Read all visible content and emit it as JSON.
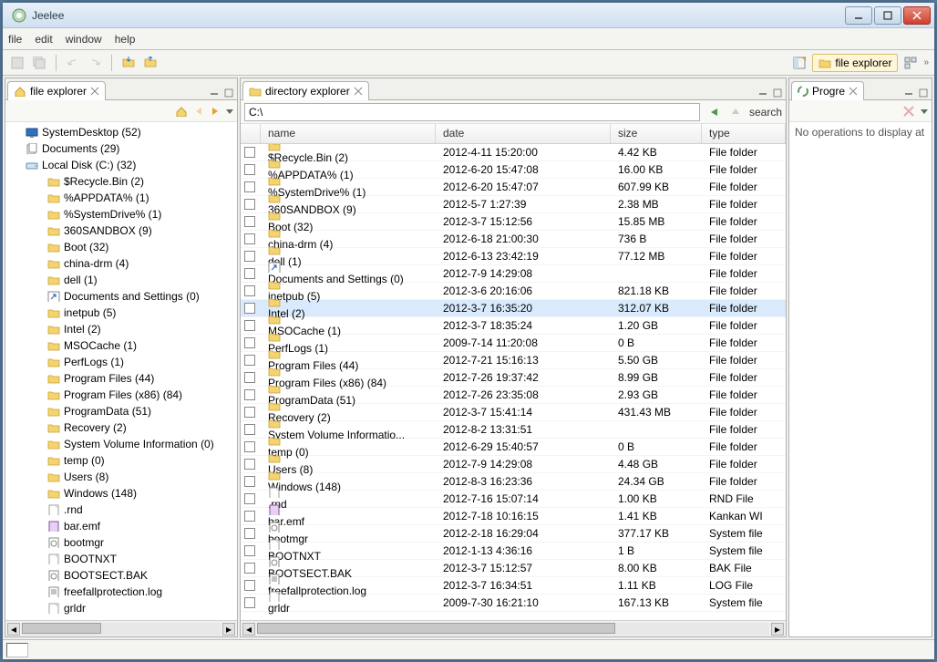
{
  "window": {
    "title": "Jeelee"
  },
  "menu": {
    "file": "file",
    "edit": "edit",
    "window": "window",
    "help": "help"
  },
  "perspective": {
    "label": "file explorer"
  },
  "panes": {
    "left": {
      "tab": "file explorer"
    },
    "mid": {
      "tab": "directory explorer",
      "address": "C:\\",
      "search": "search"
    },
    "right": {
      "tab": "Progre",
      "message": "No operations to display at"
    }
  },
  "columns": {
    "name": "name",
    "date": "date",
    "size": "size",
    "type": "type"
  },
  "tree": [
    {
      "indent": 0,
      "icon": "monitor",
      "label": "SystemDesktop (52)"
    },
    {
      "indent": 0,
      "icon": "docs",
      "label": "Documents (29)"
    },
    {
      "indent": 0,
      "icon": "drive",
      "label": "Local Disk (C:) (32)"
    },
    {
      "indent": 1,
      "icon": "folder",
      "label": "$Recycle.Bin (2)"
    },
    {
      "indent": 1,
      "icon": "folder",
      "label": "%APPDATA% (1)"
    },
    {
      "indent": 1,
      "icon": "folder",
      "label": "%SystemDrive% (1)"
    },
    {
      "indent": 1,
      "icon": "folder",
      "label": "360SANDBOX (9)"
    },
    {
      "indent": 1,
      "icon": "folder",
      "label": "Boot (32)"
    },
    {
      "indent": 1,
      "icon": "folder",
      "label": "china-drm (4)"
    },
    {
      "indent": 1,
      "icon": "folder",
      "label": "dell (1)"
    },
    {
      "indent": 1,
      "icon": "link",
      "label": "Documents and Settings (0)"
    },
    {
      "indent": 1,
      "icon": "folder",
      "label": "inetpub (5)"
    },
    {
      "indent": 1,
      "icon": "folder",
      "label": "Intel (2)"
    },
    {
      "indent": 1,
      "icon": "folder",
      "label": "MSOCache (1)"
    },
    {
      "indent": 1,
      "icon": "folder",
      "label": "PerfLogs (1)"
    },
    {
      "indent": 1,
      "icon": "folder",
      "label": "Program Files (44)"
    },
    {
      "indent": 1,
      "icon": "folder",
      "label": "Program Files (x86) (84)"
    },
    {
      "indent": 1,
      "icon": "folder",
      "label": "ProgramData (51)"
    },
    {
      "indent": 1,
      "icon": "folder",
      "label": "Recovery (2)"
    },
    {
      "indent": 1,
      "icon": "folder",
      "label": "System Volume Information (0)"
    },
    {
      "indent": 1,
      "icon": "folder",
      "label": "temp (0)"
    },
    {
      "indent": 1,
      "icon": "folder",
      "label": "Users (8)"
    },
    {
      "indent": 1,
      "icon": "folder",
      "label": "Windows (148)"
    },
    {
      "indent": 1,
      "icon": "file",
      "label": ".rnd"
    },
    {
      "indent": 1,
      "icon": "emf",
      "label": "bar.emf"
    },
    {
      "indent": 1,
      "icon": "sys",
      "label": "bootmgr"
    },
    {
      "indent": 1,
      "icon": "file",
      "label": "BOOTNXT"
    },
    {
      "indent": 1,
      "icon": "sys",
      "label": "BOOTSECT.BAK"
    },
    {
      "indent": 1,
      "icon": "log",
      "label": "freefallprotection.log"
    },
    {
      "indent": 1,
      "icon": "file",
      "label": "grldr"
    }
  ],
  "rows": [
    {
      "icon": "folder",
      "name": "$Recycle.Bin (2)",
      "date": "2012-4-11 15:20:00",
      "size": "4.42 KB",
      "type": "File folder"
    },
    {
      "icon": "folder",
      "name": "%APPDATA% (1)",
      "date": "2012-6-20 15:47:08",
      "size": "16.00 KB",
      "type": "File folder"
    },
    {
      "icon": "folder",
      "name": "%SystemDrive% (1)",
      "date": "2012-6-20 15:47:07",
      "size": "607.99 KB",
      "type": "File folder"
    },
    {
      "icon": "folder",
      "name": "360SANDBOX (9)",
      "date": "2012-5-7 1:27:39",
      "size": "2.38 MB",
      "type": "File folder"
    },
    {
      "icon": "folder",
      "name": "Boot (32)",
      "date": "2012-3-7 15:12:56",
      "size": "15.85 MB",
      "type": "File folder"
    },
    {
      "icon": "folder",
      "name": "china-drm (4)",
      "date": "2012-6-18 21:00:30",
      "size": "736 B",
      "type": "File folder"
    },
    {
      "icon": "folder",
      "name": "dell (1)",
      "date": "2012-6-13 23:42:19",
      "size": "77.12 MB",
      "type": "File folder"
    },
    {
      "icon": "link",
      "name": "Documents and Settings (0)",
      "date": "2012-7-9 14:29:08",
      "size": "",
      "type": "File folder"
    },
    {
      "icon": "folder",
      "name": "inetpub (5)",
      "date": "2012-3-6 20:16:06",
      "size": "821.18 KB",
      "type": "File folder"
    },
    {
      "icon": "folder",
      "name": "Intel (2)",
      "date": "2012-3-7 16:35:20",
      "size": "312.07 KB",
      "type": "File folder",
      "sel": true
    },
    {
      "icon": "folder",
      "name": "MSOCache (1)",
      "date": "2012-3-7 18:35:24",
      "size": "1.20 GB",
      "type": "File folder"
    },
    {
      "icon": "folder",
      "name": "PerfLogs (1)",
      "date": "2009-7-14 11:20:08",
      "size": "0 B",
      "type": "File folder"
    },
    {
      "icon": "folder",
      "name": "Program Files (44)",
      "date": "2012-7-21 15:16:13",
      "size": "5.50 GB",
      "type": "File folder"
    },
    {
      "icon": "folder",
      "name": "Program Files (x86) (84)",
      "date": "2012-7-26 19:37:42",
      "size": "8.99 GB",
      "type": "File folder"
    },
    {
      "icon": "folder",
      "name": "ProgramData (51)",
      "date": "2012-7-26 23:35:08",
      "size": "2.93 GB",
      "type": "File folder"
    },
    {
      "icon": "folder",
      "name": "Recovery (2)",
      "date": "2012-3-7 15:41:14",
      "size": "431.43 MB",
      "type": "File folder"
    },
    {
      "icon": "folder",
      "name": "System Volume Informatio...",
      "date": "2012-8-2 13:31:51",
      "size": "",
      "type": "File folder"
    },
    {
      "icon": "folder",
      "name": "temp (0)",
      "date": "2012-6-29 15:40:57",
      "size": "0 B",
      "type": "File folder"
    },
    {
      "icon": "folder",
      "name": "Users (8)",
      "date": "2012-7-9 14:29:08",
      "size": "4.48 GB",
      "type": "File folder"
    },
    {
      "icon": "folder",
      "name": "Windows (148)",
      "date": "2012-8-3 16:23:36",
      "size": "24.34 GB",
      "type": "File folder"
    },
    {
      "icon": "file",
      "name": ".rnd",
      "date": "2012-7-16 15:07:14",
      "size": "1.00 KB",
      "type": "RND File"
    },
    {
      "icon": "emf",
      "name": "bar.emf",
      "date": "2012-7-18 10:16:15",
      "size": "1.41 KB",
      "type": "Kankan WI"
    },
    {
      "icon": "sys",
      "name": "bootmgr",
      "date": "2012-2-18 16:29:04",
      "size": "377.17 KB",
      "type": "System file"
    },
    {
      "icon": "file",
      "name": "BOOTNXT",
      "date": "2012-1-13 4:36:16",
      "size": "1 B",
      "type": "System file"
    },
    {
      "icon": "sys",
      "name": "BOOTSECT.BAK",
      "date": "2012-3-7 15:12:57",
      "size": "8.00 KB",
      "type": "BAK File"
    },
    {
      "icon": "log",
      "name": "freefallprotection.log",
      "date": "2012-3-7 16:34:51",
      "size": "1.11 KB",
      "type": "LOG File"
    },
    {
      "icon": "file",
      "name": "grldr",
      "date": "2009-7-30 16:21:10",
      "size": "167.13 KB",
      "type": "System file"
    }
  ]
}
